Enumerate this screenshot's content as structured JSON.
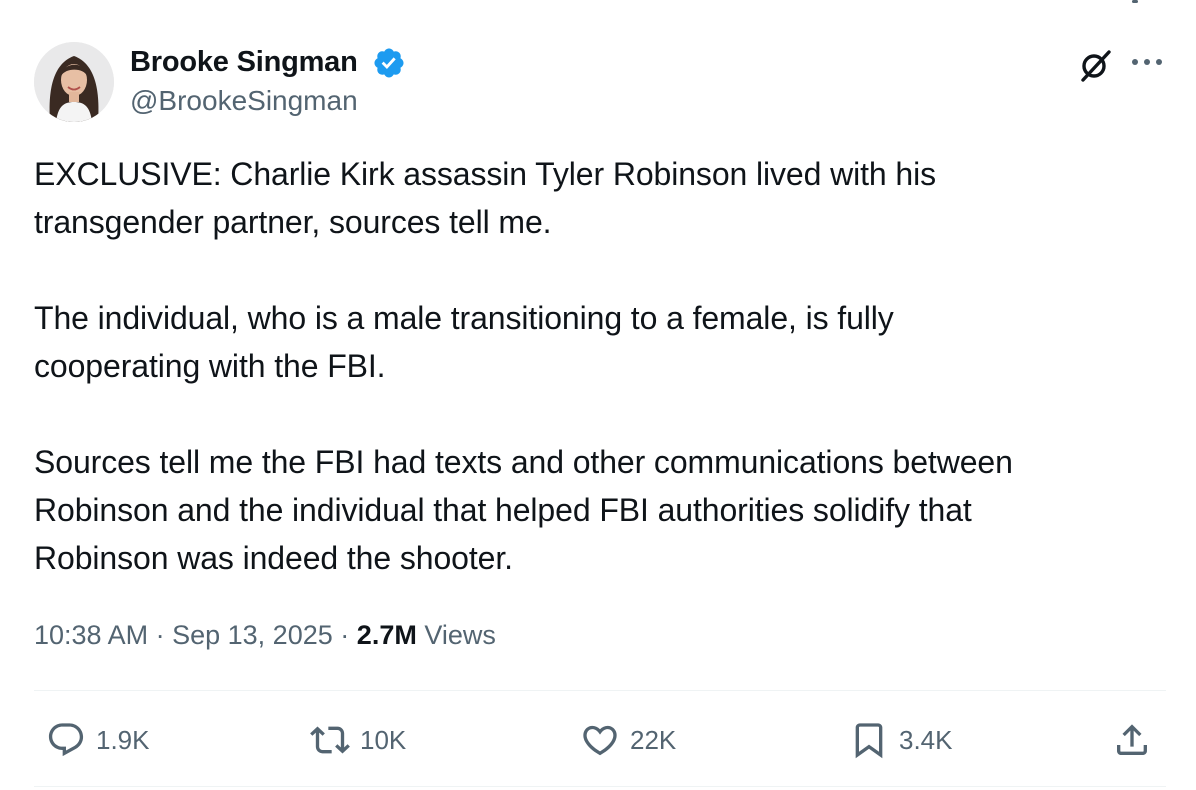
{
  "author": {
    "display_name": "Brooke Singman",
    "handle": "@BrookeSingman",
    "verified": true,
    "avatar_icon": "profile-photo",
    "verified_icon": "verified-badge-icon",
    "verified_color": "#1d9bf0"
  },
  "header_actions": {
    "grok_icon": "grok-icon",
    "more_icon": "more-options-icon"
  },
  "tweet": {
    "paragraphs": [
      "EXCLUSIVE: Charlie Kirk assassin Tyler Robinson lived with his\ntransgender partner, sources tell me.",
      "The individual, who is a male transitioning to a female, is fully\ncooperating with the FBI.",
      "Sources tell me the FBI had texts and other communications between\nRobinson and the individual that helped FBI authorities solidify that\nRobinson was indeed the shooter."
    ]
  },
  "meta": {
    "time": "10:38 AM",
    "separator": "·",
    "date": "Sep 13, 2025",
    "views_count": "2.7M",
    "views_label": "Views"
  },
  "actions": {
    "reply": {
      "icon": "reply-icon",
      "count": "1.9K"
    },
    "retweet": {
      "icon": "retweet-icon",
      "count": "10K"
    },
    "like": {
      "icon": "heart-icon",
      "count": "22K"
    },
    "bookmark": {
      "icon": "bookmark-icon",
      "count": "3.4K"
    },
    "share": {
      "icon": "share-icon"
    }
  },
  "colors": {
    "text_primary": "#0f1419",
    "text_secondary": "#536471",
    "divider": "#eff3f4",
    "accent": "#1d9bf0"
  }
}
